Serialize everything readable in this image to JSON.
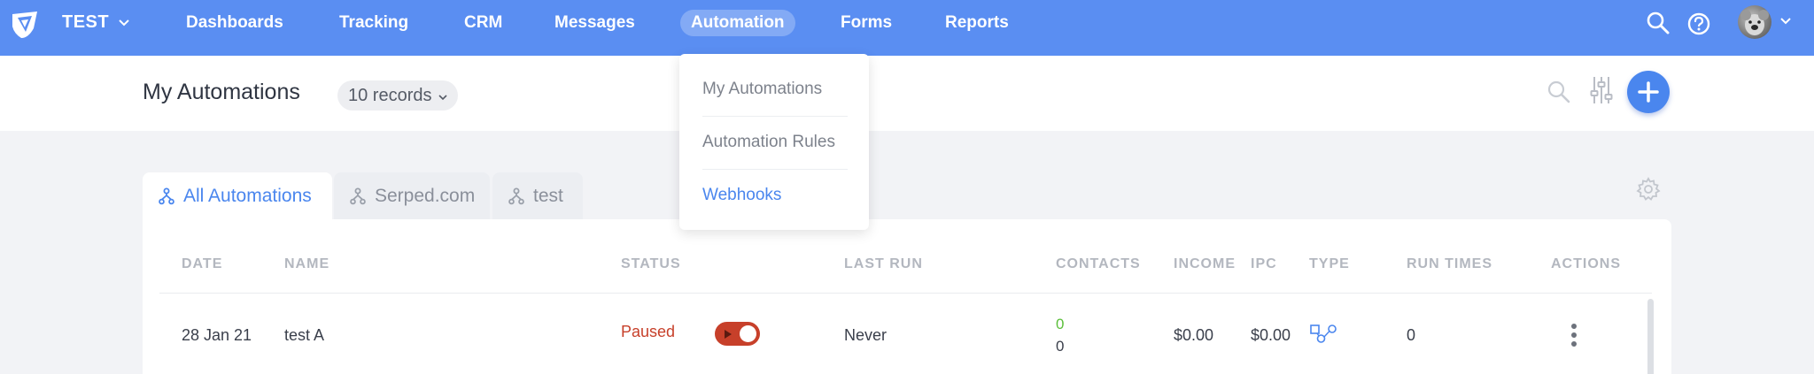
{
  "nav": {
    "workspace": "TEST",
    "items": [
      {
        "label": "Dashboards",
        "active": false
      },
      {
        "label": "Tracking",
        "active": false
      },
      {
        "label": "CRM",
        "active": false
      },
      {
        "label": "Messages",
        "active": false
      },
      {
        "label": "Automation",
        "active": true
      },
      {
        "label": "Forms",
        "active": false
      },
      {
        "label": "Reports",
        "active": false
      }
    ],
    "icons": [
      "search-icon",
      "help-icon",
      "avatar"
    ]
  },
  "header": {
    "title": "My Automations",
    "records": "10 records"
  },
  "dropdown": {
    "items": [
      {
        "label": "My Automations"
      },
      {
        "label": "Automation Rules"
      },
      {
        "label": "Webhooks"
      }
    ]
  },
  "tabs": [
    {
      "label": "All Automations",
      "active": true
    },
    {
      "label": "Serped.com",
      "active": false
    },
    {
      "label": "test",
      "active": false
    }
  ],
  "table": {
    "columns": [
      "DATE",
      "NAME",
      "STATUS",
      "LAST RUN",
      "CONTACTS",
      "INCOME",
      "IPC",
      "TYPE",
      "RUN TIMES",
      "ACTIONS"
    ],
    "rows": [
      {
        "date": "28 Jan 21",
        "name": "test A",
        "status": "Paused",
        "last_run": "Never",
        "contacts_active": "0",
        "contacts_total": "0",
        "income": "$0.00",
        "ipc": "$0.00",
        "run_times": "0"
      }
    ]
  },
  "colors": {
    "nav_bg": "#5a8ef2",
    "accent": "#4a86ee",
    "paused": "#c7402a",
    "contacts_active": "#5bbf3a"
  }
}
